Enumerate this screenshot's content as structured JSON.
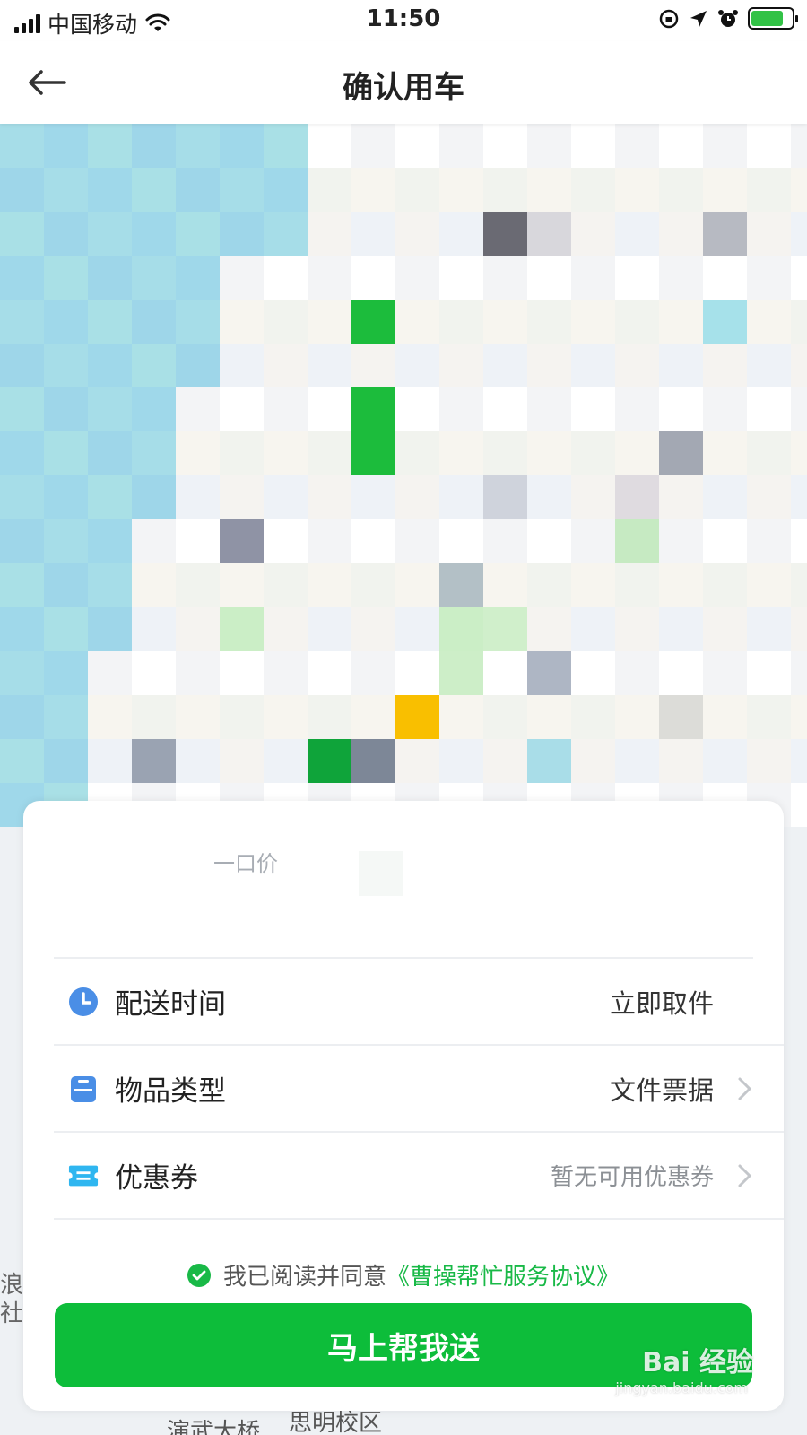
{
  "status_bar": {
    "carrier": "中国移动",
    "time": "11:50"
  },
  "nav": {
    "title": "确认用车"
  },
  "map": {
    "labels": [
      "浪",
      "社区",
      "思明校区",
      "演武大桥"
    ]
  },
  "card": {
    "price_label": "一口价",
    "rows": [
      {
        "label": "配送时间",
        "value": "立即取件",
        "icon": "clock-icon",
        "icon_color": "#4a8ee6"
      },
      {
        "label": "物品类型",
        "value": "文件票据",
        "icon": "bag-icon",
        "icon_color": "#4a8ee6"
      },
      {
        "label": "优惠券",
        "value": "暂无可用优惠券",
        "icon": "ticket-icon",
        "icon_color": "#2fb6f0"
      }
    ],
    "agreement_prefix": "我已阅读并同意",
    "agreement_link": "《曹操帮忙服务协议》",
    "submit_label": "马上帮我送"
  },
  "watermark": {
    "text": "Bai 经验",
    "sub": "jingyan.baidu.com"
  },
  "colors": {
    "accent": "#0dbd3a",
    "link": "#19b947"
  }
}
